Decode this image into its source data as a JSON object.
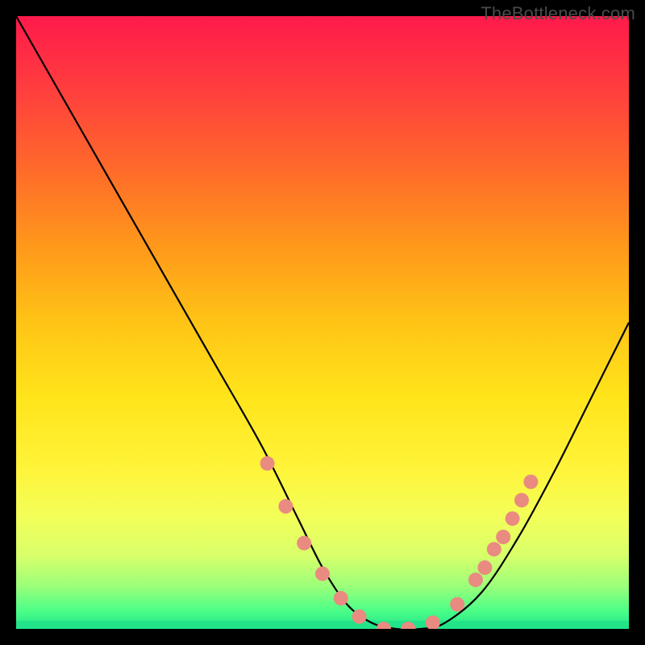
{
  "watermark": "TheBottleneck.com",
  "colors": {
    "curve": "#000000",
    "marker_fill": "#e98b80",
    "marker_stroke": "#c96a60",
    "background_top": "#ff1a4b",
    "background_bottom": "#22e38a"
  },
  "chart_data": {
    "type": "line",
    "title": "",
    "xlabel": "",
    "ylabel": "",
    "xlim": [
      0,
      100
    ],
    "ylim": [
      0,
      100
    ],
    "grid": false,
    "legend": false,
    "series": [
      {
        "name": "bottleneck-curve",
        "x": [
          0,
          8,
          16,
          24,
          32,
          40,
          46,
          50,
          54,
          58,
          62,
          66,
          70,
          76,
          82,
          88,
          94,
          100
        ],
        "y": [
          100,
          86,
          72,
          58,
          44,
          30,
          18,
          10,
          4,
          1,
          0,
          0,
          1,
          6,
          15,
          26,
          38,
          50
        ]
      }
    ],
    "markers": {
      "name": "highlighted-points",
      "x": [
        41,
        44,
        47,
        50,
        53,
        56,
        60,
        64,
        68,
        72,
        75,
        76.5,
        78,
        79.5,
        81,
        82.5,
        84
      ],
      "y": [
        27,
        20,
        14,
        9,
        5,
        2,
        0,
        0,
        1,
        4,
        8,
        10,
        13,
        15,
        18,
        21,
        24
      ]
    }
  }
}
